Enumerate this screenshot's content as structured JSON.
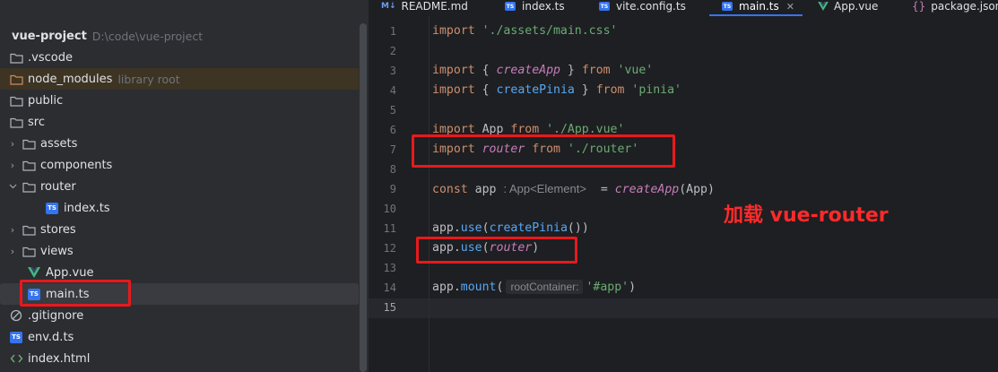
{
  "tabs": [
    {
      "label": "README.md",
      "icon": "markdown-icon"
    },
    {
      "label": "index.ts",
      "icon": "typescript-icon"
    },
    {
      "label": "vite.config.ts",
      "icon": "typescript-icon"
    },
    {
      "label": "main.ts",
      "icon": "typescript-icon",
      "active": true
    },
    {
      "label": "App.vue",
      "icon": "vue-icon"
    },
    {
      "label": "package.json",
      "icon": "json-icon"
    }
  ],
  "tree": {
    "root": {
      "name": "vue-project",
      "path": "D:\\code\\vue-project"
    },
    "items": [
      {
        "name": ".vscode"
      },
      {
        "name": "node_modules",
        "hint": "library root"
      },
      {
        "name": "public"
      },
      {
        "name": "src"
      },
      {
        "name": "assets"
      },
      {
        "name": "components"
      },
      {
        "name": "router"
      },
      {
        "name": "index.ts"
      },
      {
        "name": "stores"
      },
      {
        "name": "views"
      },
      {
        "name": "App.vue"
      },
      {
        "name": "main.ts"
      },
      {
        "name": ".gitignore"
      },
      {
        "name": "env.d.ts"
      },
      {
        "name": "index.html"
      }
    ]
  },
  "ts_badge": "TS",
  "code": {
    "line_numbers": [
      "1",
      "2",
      "3",
      "4",
      "5",
      "6",
      "7",
      "8",
      "9",
      "10",
      "11",
      "12",
      "13",
      "14",
      "15"
    ],
    "tokens": {
      "import": "import",
      "from": "from",
      "const": "const",
      "main_css": "'./assets/main.css'",
      "createApp": "createApp",
      "createPinia": "createPinia",
      "vue": "'vue'",
      "pinia": "'pinia'",
      "App": "App",
      "app_vue": "'./App.vue'",
      "router": "router",
      "router_path": "'./router'",
      "app": "app",
      "type_hint": ": App<Element>",
      "use": "use",
      "mount": "mount",
      "root_hint": "rootContainer:",
      "app_selector": "'#app'",
      "lbrace": "{",
      "rbrace": "}",
      "eq": "=",
      "lparen": "(",
      "rparen": ")",
      "dot": "."
    }
  },
  "annotation": "加载 vue-router",
  "colors": {
    "highlight_red": "#e8191c",
    "annotation_red": "#ff2a2a",
    "keyword": "#cf8e6d",
    "string": "#6aab73",
    "function": "#56a8f5",
    "ts_badge": "#3574f0"
  }
}
